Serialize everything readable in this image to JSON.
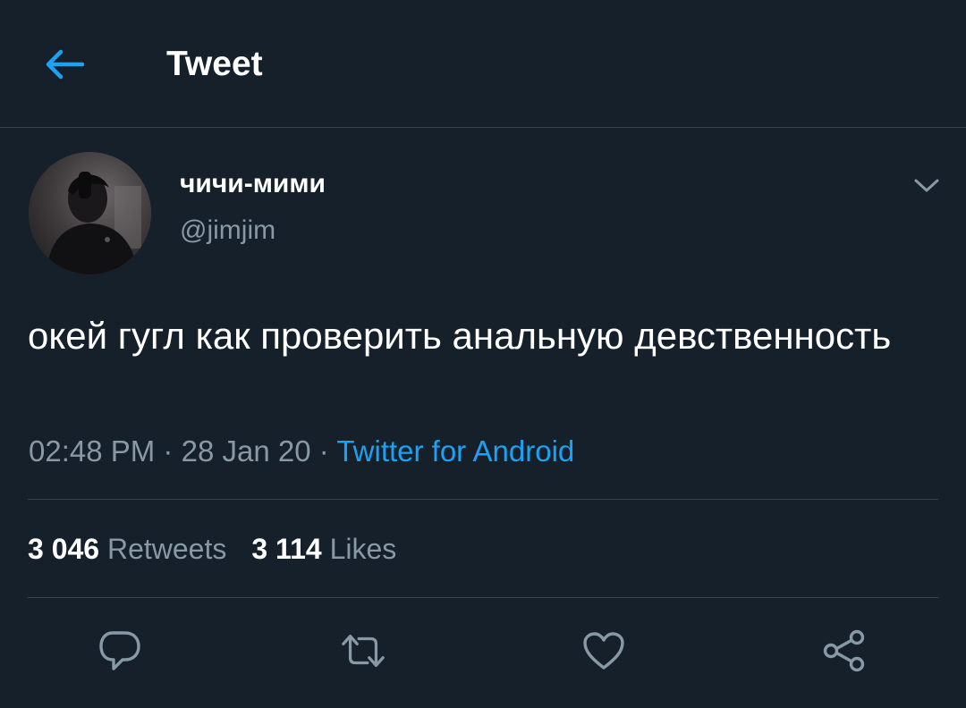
{
  "header": {
    "title": "Tweet",
    "back_icon": "arrow-left-icon"
  },
  "tweet": {
    "display_name": "чичи-мими",
    "handle": "@jimjim",
    "text": "окей гугл как проверить анальную девственность",
    "time": "02:48 PM",
    "date": "28 Jan 20",
    "separator": "·",
    "source": "Twitter for Android"
  },
  "stats": {
    "retweets_count": "3 046",
    "retweets_label": "Retweets",
    "likes_count": "3 114",
    "likes_label": "Likes"
  },
  "actions": [
    {
      "name": "reply",
      "icon": "speech-bubble-icon"
    },
    {
      "name": "retweet",
      "icon": "retweet-arrows-icon"
    },
    {
      "name": "like",
      "icon": "heart-icon"
    },
    {
      "name": "share",
      "icon": "share-nodes-icon"
    }
  ],
  "colors": {
    "background": "#15202b",
    "accent": "#1da1f2",
    "secondary_text": "#8899a6",
    "divider": "#38444d"
  }
}
